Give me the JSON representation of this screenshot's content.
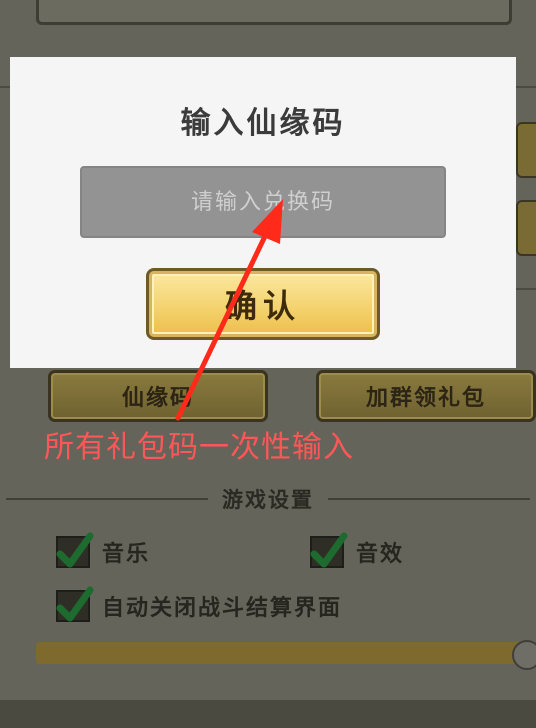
{
  "background": {
    "buttons": {
      "immortal_code": "仙缘码",
      "join_group_gift": "加群领礼包"
    },
    "settings": {
      "title": "游戏设置",
      "options": [
        {
          "label": "音乐",
          "checked": true
        },
        {
          "label": "音效",
          "checked": true
        },
        {
          "label": "自动关闭战斗结算界面",
          "checked": true
        }
      ]
    }
  },
  "dialog": {
    "title": "输入仙缘码",
    "input": {
      "placeholder": "请输入兑换码",
      "value": ""
    },
    "confirm_label": "确认"
  },
  "annotation": {
    "text": "所有礼包码一次性输入",
    "color": "#ff4d4d"
  }
}
